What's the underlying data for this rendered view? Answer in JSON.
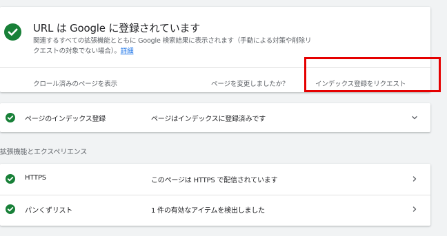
{
  "status_card": {
    "title": "URL は Google に登録されています",
    "description": "関連するすべての拡張機能とともに Google 検索結果に表示されます（手動による対策や削除リクエストの対象でない場合）。",
    "details_link": "詳細",
    "view_crawled_label": "クロール済みのページを表示",
    "page_changed_text": "ページを変更しましたか？",
    "request_indexing_label": "インデックス登録をリクエスト"
  },
  "index_row": {
    "label": "ページのインデックス登録",
    "value": "ページはインデックスに登録済みです"
  },
  "enhancements": {
    "heading": "拡張機能とエクスペリエンス",
    "rows": [
      {
        "label": "HTTPS",
        "value": "このページは HTTPS で配信されています"
      },
      {
        "label": "パンくずリスト",
        "value": "1 件の有効なアイテムを検出しました"
      }
    ]
  },
  "colors": {
    "success_green": "#188038",
    "link_blue": "#1a73e8",
    "highlight_red": "#e50000"
  },
  "icons": {
    "status": "check-circle-icon",
    "expand": "chevron-down-icon",
    "navigate": "chevron-right-icon"
  }
}
